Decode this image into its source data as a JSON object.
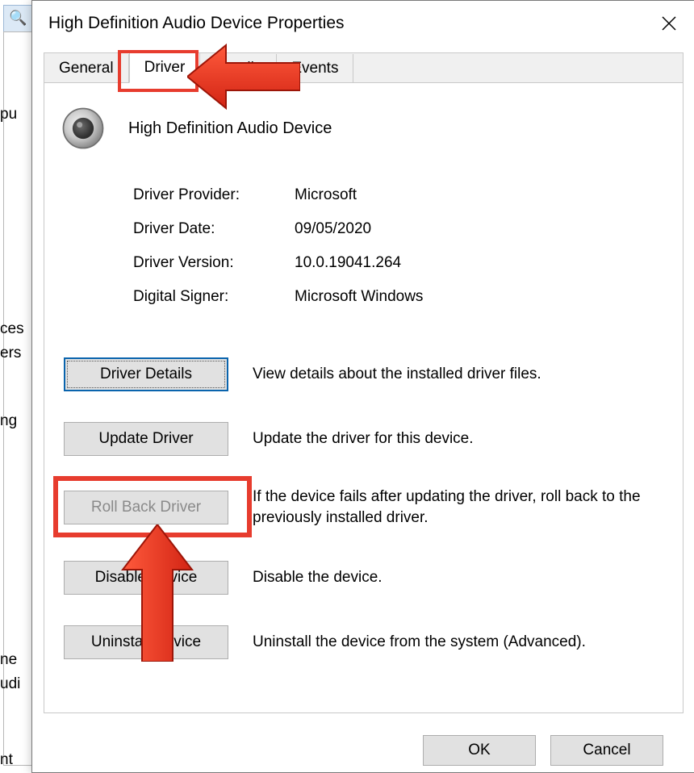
{
  "dialog": {
    "title": "High Definition Audio Device Properties",
    "tabs": [
      "General",
      "Driver",
      "Details",
      "Events"
    ],
    "active_tab_index": 1,
    "device_name": "High Definition Audio Device",
    "info": {
      "provider_label": "Driver Provider:",
      "provider_value": "Microsoft",
      "date_label": "Driver Date:",
      "date_value": "09/05/2020",
      "version_label": "Driver Version:",
      "version_value": "10.0.19041.264",
      "signer_label": "Digital Signer:",
      "signer_value": "Microsoft Windows"
    },
    "buttons": {
      "details": {
        "label": "Driver Details",
        "desc": "View details about the installed driver files."
      },
      "update": {
        "label": "Update Driver",
        "desc": "Update the driver for this device."
      },
      "rollback": {
        "label": "Roll Back Driver",
        "desc": "If the device fails after updating the driver, roll back to the previously installed driver."
      },
      "disable": {
        "label": "Disable Device",
        "desc": "Disable the device."
      },
      "uninstall": {
        "label": "Uninstall Device",
        "desc": "Uninstall the device from the system (Advanced)."
      }
    },
    "ok": "OK",
    "cancel": "Cancel"
  },
  "background": {
    "frag1": "pu",
    "frag2": "ces",
    "frag3": "ers",
    "frag4": "ng",
    "frag5": "ne",
    "frag6": "udi",
    "frag7": "nt"
  },
  "annotations": {
    "highlight_color": "#e73c2e"
  }
}
